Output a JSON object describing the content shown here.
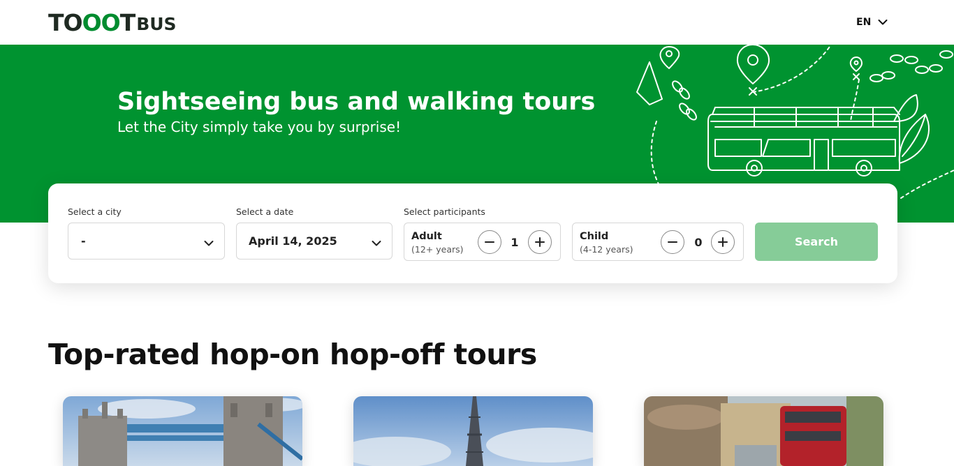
{
  "header": {
    "logo": {
      "toot_prefix": "TO",
      "toot_oo": "OO",
      "toot_suffix": "T",
      "bus": "BUS"
    },
    "language": {
      "label": "EN",
      "icon": "chevron-down-icon"
    }
  },
  "hero": {
    "title": "Sightseeing bus and walking tours",
    "subtitle": "Let the City simply take you by surprise!",
    "background_color": "#009330"
  },
  "search": {
    "city": {
      "label": "Select a city",
      "value": "-"
    },
    "date": {
      "label": "Select a date",
      "value": "April 14, 2025"
    },
    "participants_label": "Select participants",
    "adult": {
      "title": "Adult",
      "ages": "(12+ years)",
      "count": "1"
    },
    "child": {
      "title": "Child",
      "ages": "(4-12 years)",
      "count": "0"
    },
    "search_label": "Search",
    "search_color": "#86cc98"
  },
  "section": {
    "title": "Top-rated hop-on hop-off tours",
    "tours": [
      {
        "image": "london-tower-bridge"
      },
      {
        "image": "paris-eiffel-tower"
      },
      {
        "image": "bath-red-bus"
      }
    ]
  }
}
